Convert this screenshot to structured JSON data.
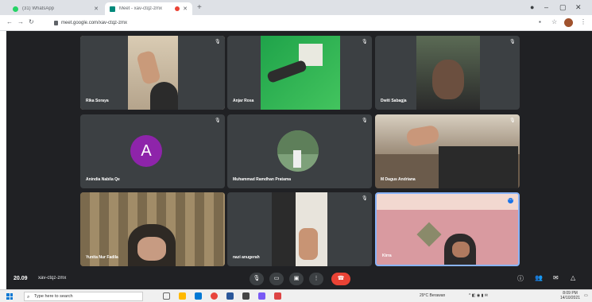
{
  "browser": {
    "tabs": [
      {
        "label": "(31) WhatsApp",
        "favicon_color": "#25d366"
      },
      {
        "label": "Meet - xav-ctqz-zmx",
        "favicon_color": "#00897b"
      }
    ],
    "url": "meet.google.com/xav-ctqz-zmx"
  },
  "participants": [
    {
      "name": "Rika Soraya"
    },
    {
      "name": "Anjar Rosa"
    },
    {
      "name": "Dwiti Sabagja"
    },
    {
      "name": "Anindia Nabila Qe",
      "avatar_letter": "A",
      "avatar_color": "#8e24aa"
    },
    {
      "name": "Muhammad Ramdhan Pratama"
    },
    {
      "name": "M Dagus Andriana"
    },
    {
      "name": "Yunita Nur Fadila"
    },
    {
      "name": "nazi anugerah"
    },
    {
      "name": "Kirra"
    }
  ],
  "meeting": {
    "time": "20.09",
    "code": "xav-ctqz-zmx"
  },
  "taskbar": {
    "search_placeholder": "Type here to search",
    "weather": "29°C Berawan",
    "clock_time": "8:09 PM",
    "clock_date": "14/10/2021"
  }
}
